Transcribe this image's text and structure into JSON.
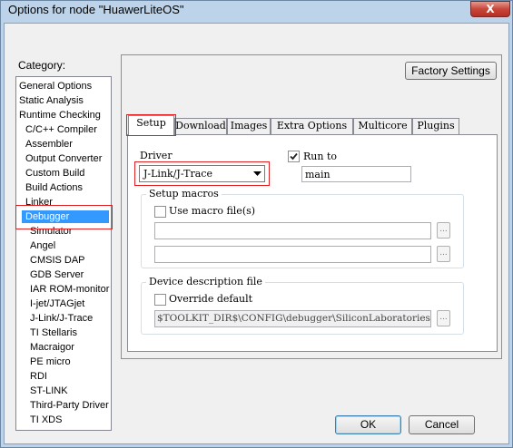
{
  "window": {
    "title": "Options for node \"HuawerLiteOS\"",
    "close_label": "X"
  },
  "category": {
    "label": "Category:",
    "items": [
      {
        "label": "General Options"
      },
      {
        "label": "Static Analysis"
      },
      {
        "label": "Runtime Checking"
      },
      {
        "label": "C/C++ Compiler"
      },
      {
        "label": "Assembler"
      },
      {
        "label": "Output Converter"
      },
      {
        "label": "Custom Build"
      },
      {
        "label": "Build Actions"
      },
      {
        "label": "Linker"
      },
      {
        "label": "Debugger"
      },
      {
        "label": "Simulator"
      },
      {
        "label": "Angel"
      },
      {
        "label": "CMSIS DAP"
      },
      {
        "label": "GDB Server"
      },
      {
        "label": "IAR ROM-monitor"
      },
      {
        "label": "I-jet/JTAGjet"
      },
      {
        "label": "J-Link/J-Trace"
      },
      {
        "label": "TI Stellaris"
      },
      {
        "label": "Macraigor"
      },
      {
        "label": "PE micro"
      },
      {
        "label": "RDI"
      },
      {
        "label": "ST-LINK"
      },
      {
        "label": "Third-Party Driver"
      },
      {
        "label": "TI XDS"
      }
    ]
  },
  "factory_settings_label": "Factory Settings",
  "tabs": [
    {
      "label": "Setup"
    },
    {
      "label": "Download"
    },
    {
      "label": "Images"
    },
    {
      "label": "Extra Options"
    },
    {
      "label": "Multicore"
    },
    {
      "label": "Plugins"
    }
  ],
  "setup": {
    "driver_label": "Driver",
    "driver_value": "J-Link/J-Trace",
    "run_to_label": "Run to",
    "run_to_checked": true,
    "run_to_value": "main",
    "setup_macros_label": "Setup macros",
    "use_macro_label": "Use macro file(s)",
    "browse_label": "...",
    "device_desc_label": "Device description file",
    "override_label": "Override default",
    "device_path": "$TOOLKIT_DIR$\\CONFIG\\debugger\\SiliconLaboratories\\"
  },
  "ok_label": "OK",
  "cancel_label": "Cancel"
}
